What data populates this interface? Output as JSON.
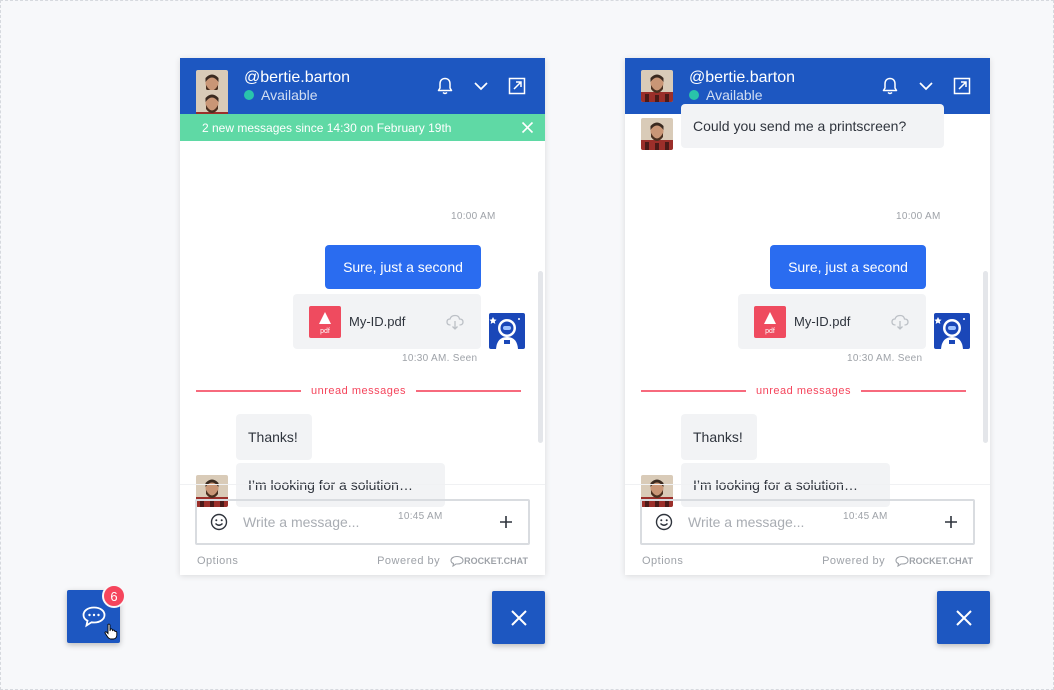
{
  "colors": {
    "header": "#1d57c1",
    "own_bubble": "#2a6cf0",
    "banner": "#5fd9a5",
    "unread": "#f5455c",
    "status_online": "#2de0a5"
  },
  "widgets": [
    {
      "header": {
        "username": "@bertie.barton",
        "status": "Available"
      },
      "banner": {
        "text": "2 new messages since 14:30 on February 19th"
      },
      "messages": {
        "first_time": "10:00 AM",
        "own_text": "Sure, just a second",
        "file_name": "My-ID.pdf",
        "file_badge": "pdf",
        "own_meta": "10:30 AM. Seen",
        "unread_label": "unread messages",
        "reply1": "Thanks!",
        "reply2": "I’m looking for a solution…",
        "reply_time": "10:45 AM"
      },
      "composer": {
        "placeholder": "Write a message...",
        "options": "Options",
        "powered": "Powered by",
        "brand": "ROCKET.CHAT"
      }
    },
    {
      "header": {
        "username": "@bertie.barton",
        "status": "Available"
      },
      "messages": {
        "first_text": "Could you send me a printscreen?",
        "first_time": "10:00 AM",
        "own_text": "Sure, just a second",
        "file_name": "My-ID.pdf",
        "file_badge": "pdf",
        "own_meta": "10:30 AM. Seen",
        "unread_label": "unread messages",
        "reply1": "Thanks!",
        "reply2": "I’m looking for a solution…",
        "reply_time": "10:45 AM"
      },
      "composer": {
        "placeholder": "Write a message...",
        "options": "Options",
        "powered": "Powered by",
        "brand": "ROCKET.CHAT"
      }
    }
  ],
  "launcher": {
    "badge_count": "6"
  }
}
